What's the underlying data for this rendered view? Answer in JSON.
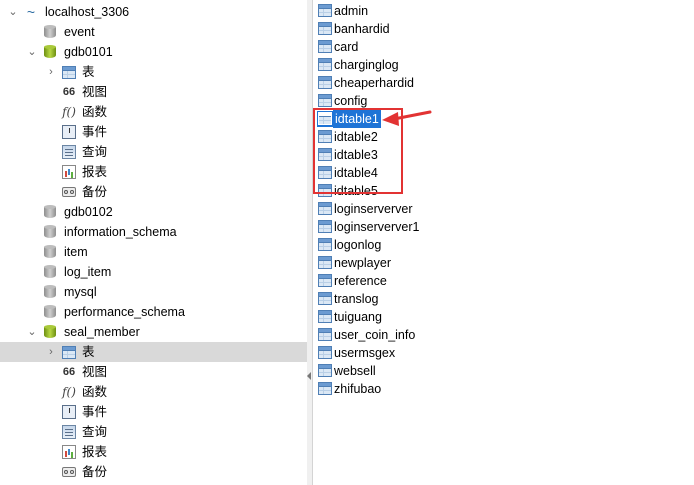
{
  "tree": {
    "root": {
      "label": "localhost_3306",
      "icon": "dolphin-icon"
    },
    "databases": [
      {
        "label": "event",
        "open": false
      },
      {
        "label": "gdb0101",
        "open": true
      },
      {
        "label": "gdb0102",
        "open": false
      },
      {
        "label": "information_schema",
        "open": false
      },
      {
        "label": "item",
        "open": false
      },
      {
        "label": "log_item",
        "open": false
      },
      {
        "label": "mysql",
        "open": false
      },
      {
        "label": "performance_schema",
        "open": false
      },
      {
        "label": "seal_member",
        "open": true
      }
    ],
    "child_labels": {
      "tables": "表",
      "views": "视图",
      "functions": "函数",
      "events": "事件",
      "queries": "查询",
      "reports": "报表",
      "backups": "备份"
    },
    "child_icons": {
      "tables": "table-icon",
      "views": "view-icon",
      "functions": "function-icon",
      "events": "event-icon",
      "queries": "query-icon",
      "reports": "report-icon",
      "backups": "backup-icon"
    },
    "func_glyph": "f()",
    "view_glyph": "66"
  },
  "tables": [
    "admin",
    "banhardid",
    "card",
    "charginglog",
    "cheaperhardid",
    "config",
    "idtable1",
    "idtable2",
    "idtable3",
    "idtable4",
    "idtable5",
    "loginserverver",
    "loginserverver1",
    "logonlog",
    "newplayer",
    "reference",
    "translog",
    "tuiguang",
    "user_coin_info",
    "usermsgex",
    "websell",
    "zhifubao"
  ],
  "selected_table": "idtable1",
  "highlight": {
    "color": "#e23333",
    "covers": [
      "idtable1",
      "idtable2",
      "idtable3",
      "idtable4",
      "idtable5"
    ]
  },
  "colors": {
    "selection": "#1e74d6",
    "tree_selection": "#d9d9d9",
    "active_db": "#a9c93a"
  }
}
